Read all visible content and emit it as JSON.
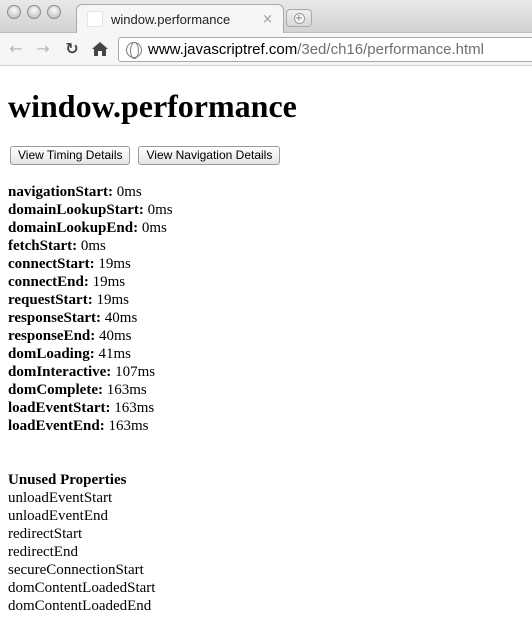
{
  "browser": {
    "tab_title": "window.performance",
    "tab_close": "×",
    "new_tab_symbol": "+",
    "url_host": "www.javascriptref.com",
    "url_path": "/3ed/ch16/performance.html"
  },
  "page": {
    "heading": "window.performance",
    "buttons": {
      "timing": "View Timing Details",
      "navigation": "View Navigation Details"
    },
    "timings": [
      {
        "name": "navigationStart:",
        "value": "0ms"
      },
      {
        "name": "domainLookupStart:",
        "value": "0ms"
      },
      {
        "name": "domainLookupEnd:",
        "value": "0ms"
      },
      {
        "name": "fetchStart:",
        "value": "0ms"
      },
      {
        "name": "connectStart:",
        "value": "19ms"
      },
      {
        "name": "connectEnd:",
        "value": "19ms"
      },
      {
        "name": "requestStart:",
        "value": "19ms"
      },
      {
        "name": "responseStart:",
        "value": "40ms"
      },
      {
        "name": "responseEnd:",
        "value": "40ms"
      },
      {
        "name": "domLoading:",
        "value": "41ms"
      },
      {
        "name": "domInteractive:",
        "value": "107ms"
      },
      {
        "name": "domComplete:",
        "value": "163ms"
      },
      {
        "name": "loadEventStart:",
        "value": "163ms"
      },
      {
        "name": "loadEventEnd:",
        "value": "163ms"
      }
    ],
    "unused_heading": "Unused Properties",
    "unused": [
      "unloadEventStart",
      "unloadEventEnd",
      "redirectStart",
      "redirectEnd",
      "secureConnectionStart",
      "domContentLoadedStart",
      "domContentLoadedEnd"
    ]
  }
}
